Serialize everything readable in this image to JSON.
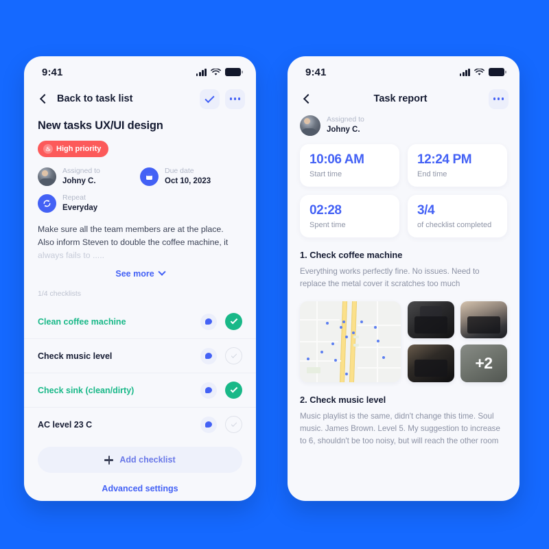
{
  "theme": {
    "background": "#1569ff",
    "phone_bg": "#f7f8fc",
    "accent_blue": "#4361f5",
    "accent_green": "#19b888",
    "accent_red": "#fc5a5a",
    "muted_text": "#8b91a4"
  },
  "left_phone": {
    "status_bar": {
      "time": "9:41",
      "signal_icon": "cellular-signal-icon",
      "wifi_icon": "wifi-icon",
      "battery_icon": "battery-full-icon"
    },
    "nav": {
      "back_icon": "chevron-left-icon",
      "back_label": "Back to task list",
      "confirm_icon": "check-icon",
      "more_icon": "ellipsis-icon"
    },
    "task_title": "New tasks UX/UI design",
    "priority_badge": {
      "label": "High priority",
      "icon": "flame-icon",
      "color": "#fc5a5a"
    },
    "meta": [
      {
        "icon": "avatar",
        "label": "Assigned to",
        "value": "Johny C."
      },
      {
        "icon": "calendar-icon",
        "label": "Due date",
        "value": "Oct 10, 2023"
      },
      {
        "icon": "repeat-icon",
        "label": "Repeat",
        "value": "Everyday"
      }
    ],
    "description": {
      "line1": "Make sure all the team members are at the place.",
      "line2": "Also inform Steven to double the coffee machine, it",
      "line3": "always fails to ....."
    },
    "see_more": {
      "label": "See more",
      "icon": "chevron-down-icon"
    },
    "checklist_count": "1/4 checklists",
    "checklist": [
      {
        "label": "Clean coffee machine",
        "done": true,
        "comment_icon": "comment-bubble-icon",
        "check_icon": "check-circle-icon"
      },
      {
        "label": "Check music level",
        "done": false,
        "comment_icon": "comment-bubble-icon",
        "check_icon": "check-circle-icon"
      },
      {
        "label": "Check sink (clean/dirty)",
        "done": true,
        "comment_icon": "comment-bubble-icon",
        "check_icon": "check-circle-icon"
      },
      {
        "label": "AC level 23 C",
        "done": false,
        "comment_icon": "comment-bubble-icon",
        "check_icon": "check-circle-icon"
      }
    ],
    "add_checklist": {
      "label": "Add checklist",
      "icon": "plus-icon"
    },
    "advanced_settings": "Advanced settings"
  },
  "right_phone": {
    "status_bar": {
      "time": "9:41",
      "signal_icon": "cellular-signal-icon",
      "wifi_icon": "wifi-icon",
      "battery_icon": "battery-full-icon"
    },
    "nav": {
      "back_icon": "chevron-left-icon",
      "title": "Task report",
      "more_icon": "ellipsis-icon"
    },
    "assigned": {
      "label": "Assigned to",
      "value": "Johny C.",
      "icon": "avatar"
    },
    "stats": [
      {
        "value": "10:06 AM",
        "label": "Start time"
      },
      {
        "value": "12:24 PM",
        "label": "End time"
      },
      {
        "value": "02:28",
        "label": "Spent time"
      },
      {
        "value": "3/4",
        "label": "of checklist completed"
      }
    ],
    "sections": [
      {
        "title": "1. Check coffee machine",
        "body": "Everything works perfectly fine. No issues. Need to replace the metal cover it scratches too much"
      },
      {
        "title": "2. Check music level",
        "body": "Music playlist is the same, didn't change this time. Soul music. James Brown. Level 5. My suggestion to increase to 6, shouldn't be too noisy, but will reach the other room"
      }
    ],
    "gallery": {
      "map_thumbnail": "map-thumbnail",
      "photos": [
        "coffee-machine-photo-1",
        "coffee-machine-photo-2",
        "coffee-machine-photo-3",
        "sink-photo"
      ],
      "overflow_label": "+2"
    }
  }
}
